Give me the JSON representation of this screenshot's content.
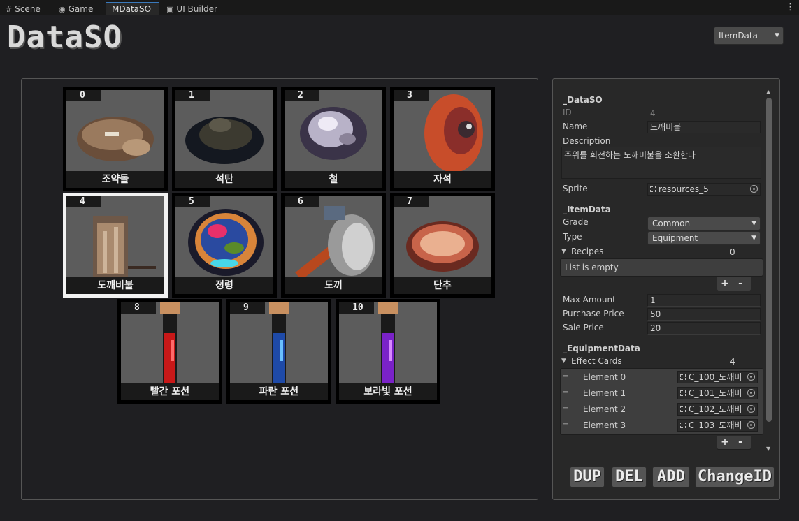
{
  "tabs": [
    {
      "label": "Scene",
      "icon": "scene-icon"
    },
    {
      "label": "Game",
      "icon": "gamepad-icon"
    },
    {
      "label": "MDataSO",
      "icon": ""
    },
    {
      "label": "UI Builder",
      "icon": "window-icon"
    }
  ],
  "header": {
    "title": "DataSO",
    "type_selector": "ItemData"
  },
  "items": [
    {
      "id": "0",
      "name": "조약돌",
      "sprite": "pebble"
    },
    {
      "id": "1",
      "name": "석탄",
      "sprite": "coal"
    },
    {
      "id": "2",
      "name": "철",
      "sprite": "iron"
    },
    {
      "id": "3",
      "name": "자석",
      "sprite": "magnet"
    },
    {
      "id": "4",
      "name": "도깨비불",
      "sprite": "torch",
      "selected": true
    },
    {
      "id": "5",
      "name": "정령",
      "sprite": "spirit"
    },
    {
      "id": "6",
      "name": "도끼",
      "sprite": "axe"
    },
    {
      "id": "7",
      "name": "단추",
      "sprite": "button"
    },
    {
      "id": "8",
      "name": "빨간 포션",
      "sprite": "red-potion"
    },
    {
      "id": "9",
      "name": "파란 포션",
      "sprite": "blue-potion"
    },
    {
      "id": "10",
      "name": "보라빛 포션",
      "sprite": "purple-potion"
    }
  ],
  "inspector": {
    "dataso_header": "_DataSO",
    "id_label": "ID",
    "id_value": "4",
    "name_label": "Name",
    "name_value": "도깨비불",
    "description_label": "Description",
    "description_value": "주위를 회전하는 도깨비불을 소환한다",
    "sprite_label": "Sprite",
    "sprite_value": "resources_5",
    "itemdata_header": "_ItemData",
    "grade_label": "Grade",
    "grade_value": "Common",
    "type_label": "Type",
    "type_value": "Equipment",
    "recipes_label": "Recipes",
    "recipes_count": "0",
    "recipes_empty": "List is empty",
    "max_amount_label": "Max Amount",
    "max_amount_value": "1",
    "purchase_price_label": "Purchase Price",
    "purchase_price_value": "50",
    "sale_price_label": "Sale Price",
    "sale_price_value": "20",
    "equipment_header": "_EquipmentData",
    "effect_cards_label": "Effect Cards",
    "effect_cards_count": "4",
    "effect_cards": [
      {
        "label": "Element 0",
        "value": "C_100_도깨비"
      },
      {
        "label": "Element 1",
        "value": "C_101_도깨비"
      },
      {
        "label": "Element 2",
        "value": "C_102_도깨비"
      },
      {
        "label": "Element 3",
        "value": "C_103_도깨비"
      }
    ],
    "plus": "+",
    "minus": "-"
  },
  "actions": {
    "dup": "DUP",
    "del": "DEL",
    "add": "ADD",
    "change_id": "ChangeID"
  }
}
